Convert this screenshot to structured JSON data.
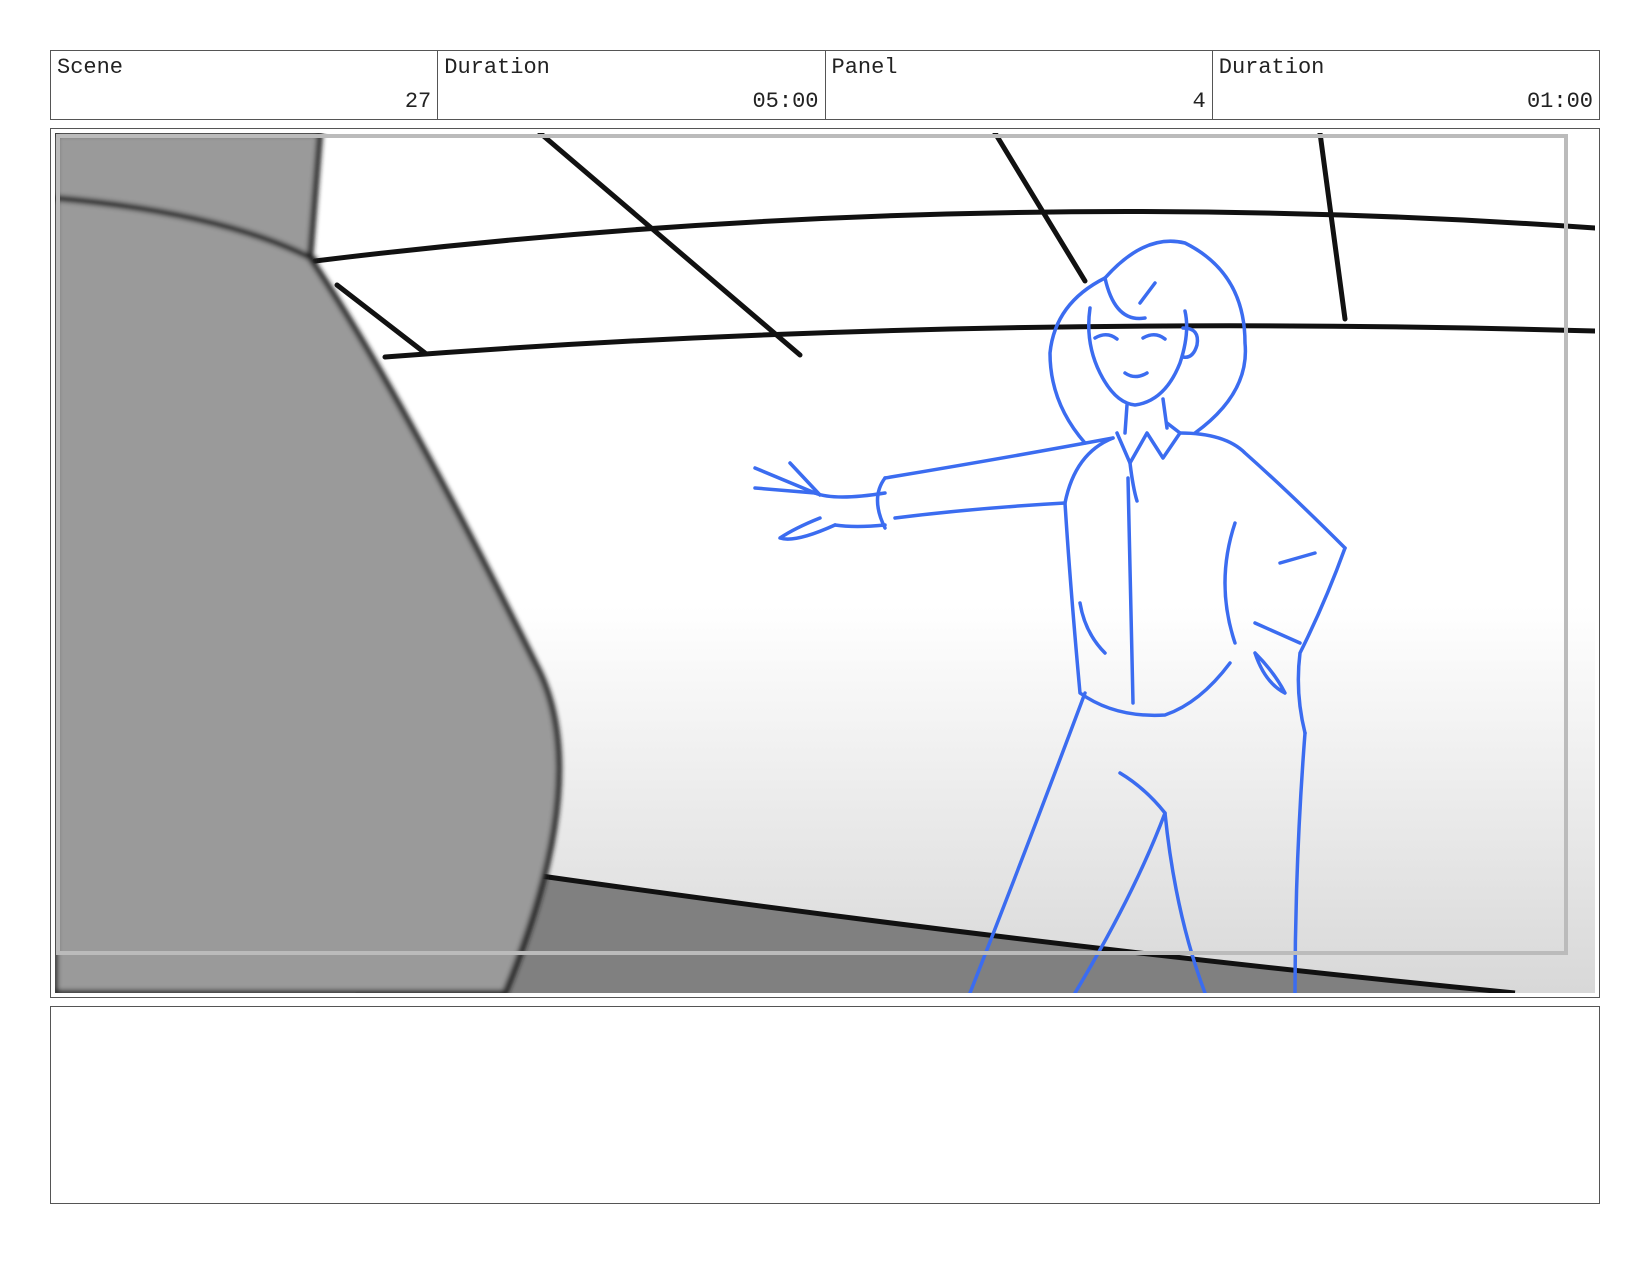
{
  "header": {
    "scene_label": "Scene",
    "scene_value": "27",
    "scene_duration_label": "Duration",
    "scene_duration_value": "05:00",
    "panel_label": "Panel",
    "panel_value": "4",
    "panel_duration_label": "Duration",
    "panel_duration_value": "01:00"
  },
  "colors": {
    "sketch_line": "#3b6cf0",
    "ink_line": "#111111",
    "foreground_gray": "#9a9a9a",
    "floor_gray": "#7f7f7f"
  }
}
